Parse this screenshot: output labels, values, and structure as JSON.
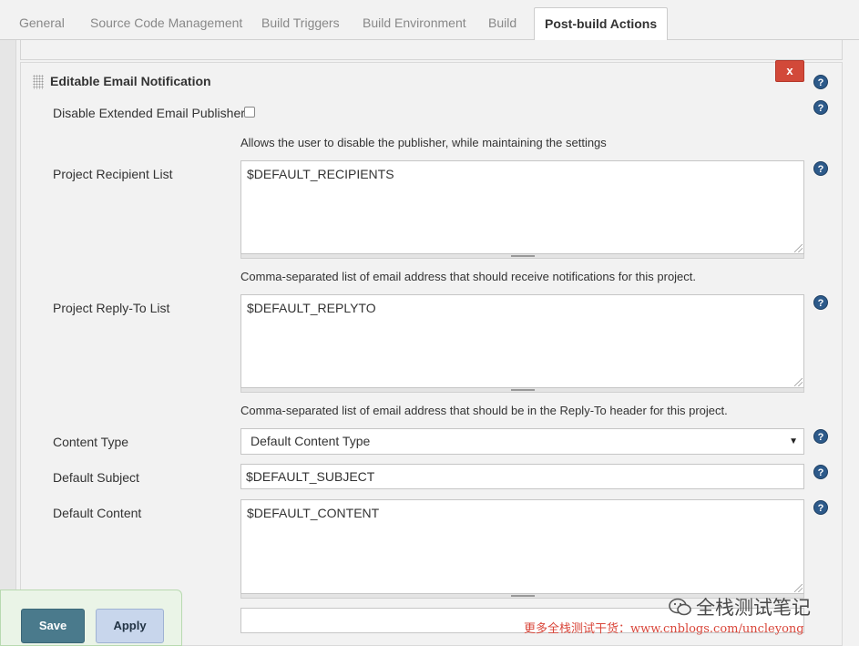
{
  "tabs": [
    {
      "label": "General"
    },
    {
      "label": "Source Code Management"
    },
    {
      "label": "Build Triggers"
    },
    {
      "label": "Build Environment"
    },
    {
      "label": "Build"
    },
    {
      "label": "Post-build Actions",
      "active": true
    }
  ],
  "section": {
    "title": "Editable Email Notification",
    "delete_label": "x"
  },
  "fields": {
    "disable_publisher": {
      "label": "Disable Extended Email Publisher",
      "checked": false,
      "description": "Allows the user to disable the publisher, while maintaining the settings"
    },
    "recipient_list": {
      "label": "Project Recipient List",
      "value": "$DEFAULT_RECIPIENTS",
      "description": "Comma-separated list of email address that should receive notifications for this project."
    },
    "reply_to_list": {
      "label": "Project Reply-To List",
      "value": "$DEFAULT_REPLYTO",
      "description": "Comma-separated list of email address that should be in the Reply-To header for this project."
    },
    "content_type": {
      "label": "Content Type",
      "value": "Default Content Type"
    },
    "default_subject": {
      "label": "Default Subject",
      "value": "$DEFAULT_SUBJECT"
    },
    "default_content": {
      "label": "Default Content",
      "value": "$DEFAULT_CONTENT"
    }
  },
  "help_glyph": "?",
  "select_arrow": "▼",
  "buttons": {
    "save": "Save",
    "apply": "Apply"
  },
  "watermark": {
    "brand": "全栈测试笔记",
    "line": "更多全栈测试干货：www.cnblogs.com/uncleyong"
  },
  "colors": {
    "delete": "#d24939",
    "save": "#4a7a8c",
    "apply": "#c8d6ec",
    "help": "#2d5a8a",
    "watermark": "#d9463a"
  }
}
